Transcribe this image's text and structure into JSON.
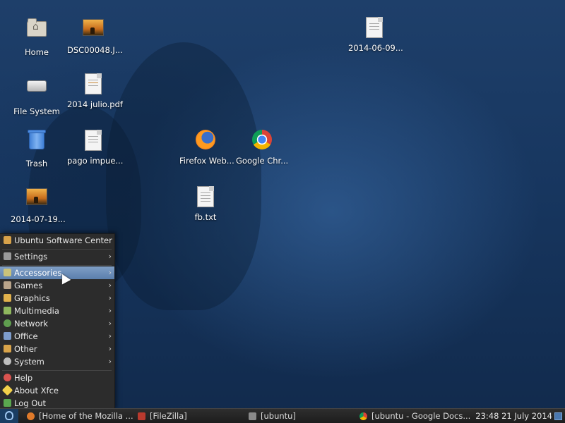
{
  "desktop": {
    "icons": [
      {
        "label": "Home",
        "icon": "home-folder-icon"
      },
      {
        "label": "DSC00048.J...",
        "icon": "image-file-icon"
      },
      {
        "label": "2014-06-09...",
        "icon": "document-file-icon"
      },
      {
        "label": "File System",
        "icon": "drive-icon"
      },
      {
        "label": "2014 julio.pdf",
        "icon": "pdf-file-icon"
      },
      {
        "label": "Trash",
        "icon": "trash-icon"
      },
      {
        "label": "pago impue...",
        "icon": "document-file-icon"
      },
      {
        "label": "Firefox Web...",
        "icon": "firefox-icon"
      },
      {
        "label": "Google Chr...",
        "icon": "chrome-icon"
      },
      {
        "label": "2014-07-19...",
        "icon": "image-file-icon"
      },
      {
        "label": "fb.txt",
        "icon": "text-file-icon"
      }
    ]
  },
  "menu": {
    "items": [
      {
        "label": "Ubuntu Software Center",
        "icon": "software-center-icon",
        "submenu": false
      },
      {
        "label": "Settings",
        "icon": "settings-icon",
        "submenu": true
      },
      {
        "label": "Accessories",
        "icon": "accessories-icon",
        "submenu": true,
        "active": true
      },
      {
        "label": "Games",
        "icon": "games-icon",
        "submenu": true
      },
      {
        "label": "Graphics",
        "icon": "graphics-icon",
        "submenu": true
      },
      {
        "label": "Multimedia",
        "icon": "multimedia-icon",
        "submenu": true
      },
      {
        "label": "Network",
        "icon": "network-icon",
        "submenu": true
      },
      {
        "label": "Office",
        "icon": "office-icon",
        "submenu": true
      },
      {
        "label": "Other",
        "icon": "other-icon",
        "submenu": true
      },
      {
        "label": "System",
        "icon": "system-icon",
        "submenu": true
      },
      {
        "label": "Help",
        "icon": "help-icon",
        "submenu": false
      },
      {
        "label": "About Xfce",
        "icon": "about-icon",
        "submenu": false
      },
      {
        "label": "Log Out",
        "icon": "logout-icon",
        "submenu": false
      }
    ],
    "arrow": "›"
  },
  "taskbar": {
    "tasks": [
      {
        "label": "[Home of the Mozilla ...",
        "icon": "firefox-icon"
      },
      {
        "label": "[FileZilla]",
        "icon": "filezilla-icon"
      },
      {
        "label": "[ubuntu]",
        "icon": "terminal-icon"
      },
      {
        "label": "[ubuntu - Google Docs...",
        "icon": "chrome-icon"
      }
    ],
    "clock": "23:48 21 July 2014"
  },
  "colors": {
    "menu_bg": "#2c2c2c",
    "menu_active": "#5b7fad",
    "taskbar_bg": "#1d1d1d",
    "desktop_bg": "#17365f"
  }
}
